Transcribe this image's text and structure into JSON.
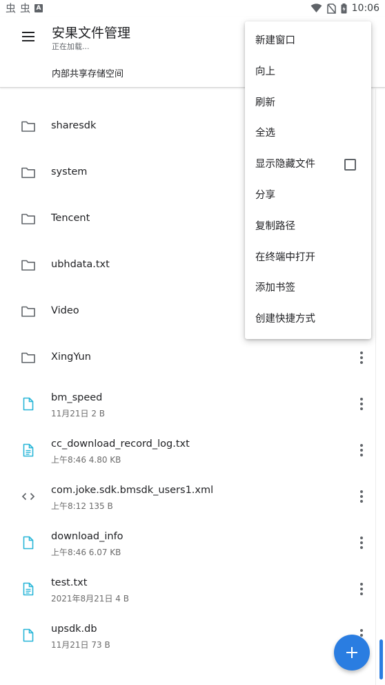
{
  "status_bar": {
    "left_glyphs": [
      "虫",
      "虫"
    ],
    "a_badge": "A",
    "time": "10:06",
    "icons": [
      "wifi-icon",
      "no-sim-icon",
      "battery-icon"
    ]
  },
  "app_bar": {
    "title": "安果文件管理",
    "subtitle": "正在加载...",
    "breadcrumb": "内部共享存储空间"
  },
  "files": [
    {
      "name": "sharesdk",
      "meta": "",
      "icon": "folder-icon"
    },
    {
      "name": "system",
      "meta": "",
      "icon": "folder-icon"
    },
    {
      "name": "Tencent",
      "meta": "",
      "icon": "folder-icon"
    },
    {
      "name": "ubhdata.txt",
      "meta": "",
      "icon": "folder-icon"
    },
    {
      "name": "Video",
      "meta": "",
      "icon": "folder-icon"
    },
    {
      "name": "XingYun",
      "meta": "",
      "icon": "folder-icon"
    },
    {
      "name": "bm_speed",
      "meta": "11月21日   2 B",
      "icon": "file-icon"
    },
    {
      "name": "cc_download_record_log.txt",
      "meta": "上午8:46   4.80 KB",
      "icon": "text-file-icon"
    },
    {
      "name": "com.joke.sdk.bmsdk_users1.xml",
      "meta": "上午8:12   135 B",
      "icon": "code-file-icon"
    },
    {
      "name": "download_info",
      "meta": "上午8:46   6.07 KB",
      "icon": "file-icon"
    },
    {
      "name": "test.txt",
      "meta": "2021年8月21日   4 B",
      "icon": "text-file-icon"
    },
    {
      "name": "upsdk.db",
      "meta": "11月21日   73 B",
      "icon": "file-icon"
    }
  ],
  "menu": {
    "items": [
      "新建窗口",
      "向上",
      "刷新",
      "全选",
      "显示隐藏文件",
      "分享",
      "复制路径",
      "在终端中打开",
      "添加书签",
      "创建快捷方式"
    ],
    "show_hidden_checked": false
  },
  "colors": {
    "accent": "#2a7de1",
    "file_icon": "#29b6d8",
    "folder_icon": "#5f6368"
  }
}
